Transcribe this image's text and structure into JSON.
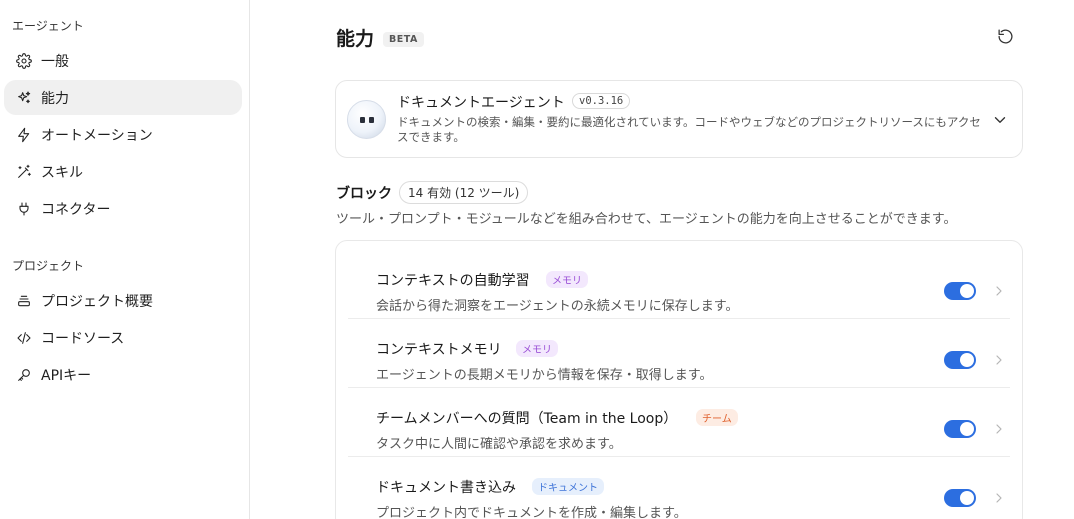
{
  "sidebar": {
    "section_agent": "エージェント",
    "section_project": "プロジェクト",
    "items": [
      {
        "label": "一般",
        "icon": "gear-icon"
      },
      {
        "label": "能力",
        "icon": "sparkles-icon",
        "active": true
      },
      {
        "label": "オートメーション",
        "icon": "lightning-icon"
      },
      {
        "label": "スキル",
        "icon": "magic-wand-icon"
      },
      {
        "label": "コネクター",
        "icon": "plug-icon"
      }
    ],
    "project_items": [
      {
        "label": "プロジェクト概要",
        "icon": "stack-icon"
      },
      {
        "label": "コードソース",
        "icon": "code-icon"
      },
      {
        "label": "APIキー",
        "icon": "key-icon"
      }
    ]
  },
  "header": {
    "title": "能力",
    "badge": "BETA",
    "reset_icon": "reset-icon"
  },
  "agent": {
    "name": "ドキュメントエージェント",
    "version": "v0.3.16",
    "description": "ドキュメントの検索・編集・要約に最適化されています。コードやウェブなどのプロジェクトリソースにもアクセスできます。"
  },
  "blocks": {
    "title": "ブロック",
    "count": "14 有効 (12 ツール)",
    "description": "ツール・プロンプト・モジュールなどを組み合わせて、エージェントの能力を向上させることができます。",
    "items": [
      {
        "name": "コンテキストの自動学習",
        "tag": "メモリ",
        "tag_kind": "memory",
        "description": "会話から得た洞察をエージェントの永続メモリに保存します。",
        "enabled": true
      },
      {
        "name": "コンテキストメモリ",
        "tag": "メモリ",
        "tag_kind": "memory",
        "description": "エージェントの長期メモリから情報を保存・取得します。",
        "enabled": true
      },
      {
        "name": "チームメンバーへの質問（Team in the Loop）",
        "tag": "チーム",
        "tag_kind": "team",
        "description": "タスク中に人間に確認や承認を求めます。",
        "enabled": true
      },
      {
        "name": "ドキュメント書き込み",
        "tag": "ドキュメント",
        "tag_kind": "doc",
        "description": "プロジェクト内でドキュメントを作成・編集します。",
        "enabled": true
      }
    ]
  },
  "colors": {
    "toggle_on": "#2c6ee0",
    "memory_tag": "#9a4fd6",
    "team_tag": "#e0622f",
    "doc_tag": "#3f74d8"
  }
}
